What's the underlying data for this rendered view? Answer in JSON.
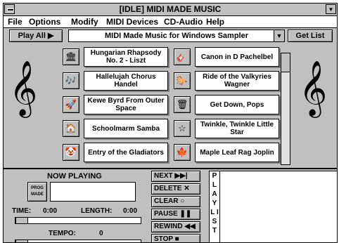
{
  "window": {
    "title": "[IDLE] MIDI MADE MUSIC"
  },
  "menu": [
    "File",
    "Options",
    "Modify",
    "MIDI Devices",
    "CD-Audio",
    "Help"
  ],
  "toolbar": {
    "play_all": "Play All ▶",
    "collection": "MIDI Made Music for Windows Sampler",
    "get_list": "Get List"
  },
  "songs": [
    {
      "title": "Hungarian Rhapsody No. 2 - Liszt",
      "icon": "house-flag-icon",
      "glyph": "🏛"
    },
    {
      "title": "Canon in D Pachelbel",
      "icon": "guitar-icon",
      "glyph": "🎸"
    },
    {
      "title": "Hallelujah Chorus Handel",
      "icon": "choir-icon",
      "glyph": "🎶"
    },
    {
      "title": "Ride of the Valkyries Wagner",
      "icon": "valkyrie-icon",
      "glyph": "🐎"
    },
    {
      "title": "Kewe Byrd From Outer Space",
      "icon": "rocket-icon",
      "glyph": "🚀"
    },
    {
      "title": "Get Down, Pops",
      "icon": "trash-can-icon",
      "glyph": "🗑"
    },
    {
      "title": "Schoolmarm Samba",
      "icon": "schoolhouse-icon",
      "glyph": "🏠"
    },
    {
      "title": "Twinkle, Twinkle Little Star",
      "icon": "star-icon",
      "glyph": "☆"
    },
    {
      "title": "Entry of the Gladiators",
      "icon": "clown-icon",
      "glyph": "🤡"
    },
    {
      "title": "Maple Leaf Rag Joplin",
      "icon": "maple-leaf-icon",
      "glyph": "🍁"
    }
  ],
  "now_playing": {
    "label": "NOW PLAYING",
    "value": "",
    "disc_label": "PROG MADE"
  },
  "time": {
    "time_label": "TIME:",
    "time_value": "0:00",
    "length_label": "LENGTH:",
    "length_value": "0:00"
  },
  "tempo": {
    "label": "TEMPO:",
    "value": "0"
  },
  "controls": {
    "next": "NEXT  ▶▶|",
    "delete": "DELETE  ✕",
    "clear": "CLEAR  ○",
    "pause": "PAUSE  ❚❚",
    "rewind": "REWIND ◀◀",
    "stop": "STOP  ■"
  },
  "playlist": {
    "label_letters": "P L A Y   L I S T"
  }
}
